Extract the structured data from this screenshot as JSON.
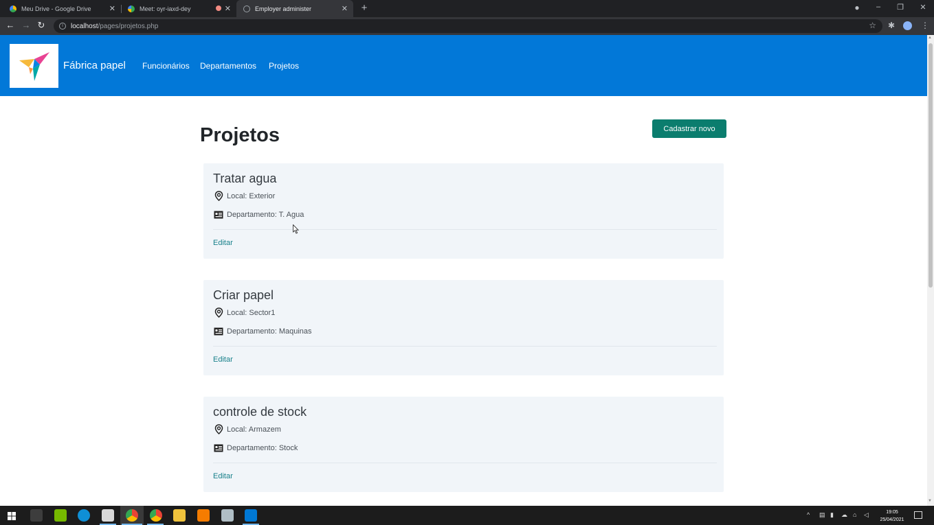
{
  "browser": {
    "tabs": [
      {
        "title": "Meu Drive - Google Drive",
        "active": false
      },
      {
        "title": "Meet: oyr-iaxd-dey",
        "active": false
      },
      {
        "title": "Employer administer",
        "active": true
      }
    ],
    "new_tab": "+",
    "url_host": "localhost",
    "url_path": "/pages/projetos.php",
    "window_controls": {
      "minimize": "–",
      "restore": "❐",
      "close": "✕"
    }
  },
  "site": {
    "brand": "Fábrica papel",
    "nav": [
      "Funcionários",
      "Departamentos",
      "Projetos"
    ]
  },
  "page": {
    "title": "Projetos",
    "new_button": "Cadastrar novo"
  },
  "projects": [
    {
      "name": "Tratar agua",
      "local": "Local: Exterior",
      "department": "Departamento: T. Agua",
      "edit": "Editar"
    },
    {
      "name": "Criar papel",
      "local": "Local: Sector1",
      "department": "Departamento: Maquinas",
      "edit": "Editar"
    },
    {
      "name": "controle de stock",
      "local": "Local: Armazem",
      "department": "Departamento: Stock",
      "edit": "Editar"
    }
  ],
  "taskbar": {
    "time": "19:05",
    "date": "25/04/2021"
  },
  "colors": {
    "header": "#0278d8",
    "button": "#0b7d6e",
    "card": "#f1f5f9",
    "link": "#17808a"
  },
  "icons": {
    "local": "location-pin-icon",
    "department": "id-card-icon"
  }
}
